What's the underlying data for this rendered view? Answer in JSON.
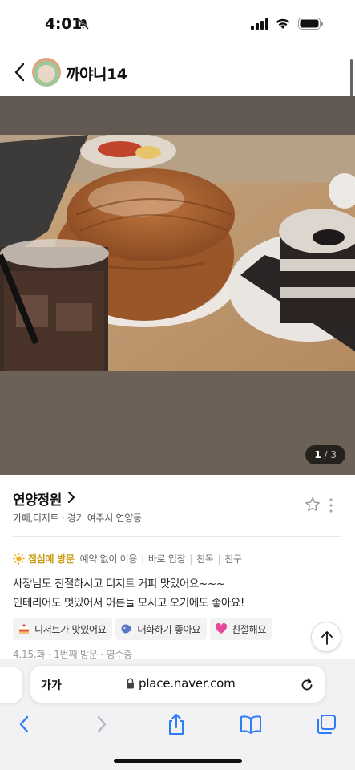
{
  "status_bar": {
    "time": "4:01"
  },
  "header": {
    "profile_name": "까야니14"
  },
  "photo": {
    "page_current": "1",
    "page_sep": " / ",
    "page_total": "3"
  },
  "place": {
    "name": "연양정원",
    "category": "카페,디저트",
    "location": "경기 여주시 연양동",
    "meta_sep": " · "
  },
  "visit": {
    "lunch_label": "점심에 방문",
    "tags": [
      "예약 없이 이용",
      "바로 입장",
      "친목",
      "친구"
    ]
  },
  "review": {
    "lines": [
      "사장님도 친절하시고 디저트 커피 맛있어요~~~",
      "인테리어도 멋있어서 어른들 모시고 오기에도 좋아요!"
    ],
    "chips": [
      {
        "label": "디저트가 맛있어요",
        "icon": "cake-icon",
        "color": "#f2a33a"
      },
      {
        "label": "대화하기 좋아요",
        "icon": "talking-icon",
        "color": "#5a78c8"
      },
      {
        "label": "친절해요",
        "icon": "heart-icon",
        "color": "#e8489a"
      }
    ],
    "date_line": "4.15.화 · 1번째 방문 · 영수증"
  },
  "browser": {
    "text_size_label": "가가",
    "url": "place.naver.com"
  }
}
